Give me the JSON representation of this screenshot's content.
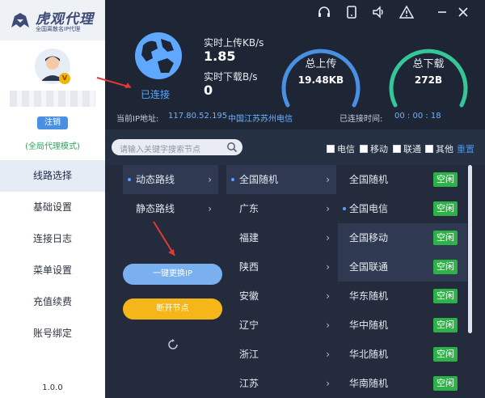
{
  "app": {
    "title": "虎观代理",
    "subtitle": "全国离散名IP代理",
    "version": "1.0.0"
  },
  "sidebar": {
    "logout": "注销",
    "mode": "(全局代理模式)",
    "items": [
      {
        "label": "线路选择"
      },
      {
        "label": "基础设置"
      },
      {
        "label": "连接日志"
      },
      {
        "label": "菜单设置"
      },
      {
        "label": "充值续费"
      },
      {
        "label": "账号绑定"
      }
    ],
    "vip": "V"
  },
  "status": {
    "connection": "已连接",
    "upload_label": "实时上传KB/s",
    "upload_value": "1.85",
    "download_label": "实时下载B/s",
    "download_value": "0",
    "total_upload_label": "总上传",
    "total_upload_value": "19.48KB",
    "total_download_label": "总下载",
    "total_download_value": "272B",
    "ip_label": "当前IP地址:",
    "ip_value": "117.80.52.195",
    "ip_location": "中国江苏苏州电信",
    "time_label": "已连接时间:",
    "time_value": "00 : 00 : 18"
  },
  "filter": {
    "search_placeholder": "请输入关键字搜索节点",
    "isps": [
      "电信",
      "移动",
      "联通",
      "其他"
    ],
    "settings": "重置"
  },
  "routes": {
    "col1": [
      {
        "label": "动态路线",
        "selected": true
      },
      {
        "label": "静态路线",
        "selected": false
      }
    ],
    "col2": [
      {
        "label": "全国随机",
        "selected": true
      },
      {
        "label": "广东"
      },
      {
        "label": "福建"
      },
      {
        "label": "陕西"
      },
      {
        "label": "安徽"
      },
      {
        "label": "辽宁"
      },
      {
        "label": "浙江"
      },
      {
        "label": "江苏"
      }
    ],
    "col3": [
      {
        "label": "全国随机",
        "status": "空闲"
      },
      {
        "label": "全国电信",
        "status": "空闲",
        "selected": true
      },
      {
        "label": "全国移动",
        "status": "空闲"
      },
      {
        "label": "全国联通",
        "status": "空闲"
      },
      {
        "label": "华东随机",
        "status": "空闲"
      },
      {
        "label": "华中随机",
        "status": "空闲"
      },
      {
        "label": "华北随机",
        "status": "空闲"
      },
      {
        "label": "华南随机",
        "status": "空闲"
      }
    ]
  },
  "actions": {
    "change_ip": "一键更换IP",
    "disconnect": "断开节点"
  },
  "colors": {
    "accent": "#4a90e2",
    "free": "#2fb14a",
    "gauge_green": "#35c79a",
    "gauge_blue": "#4a90e2"
  }
}
